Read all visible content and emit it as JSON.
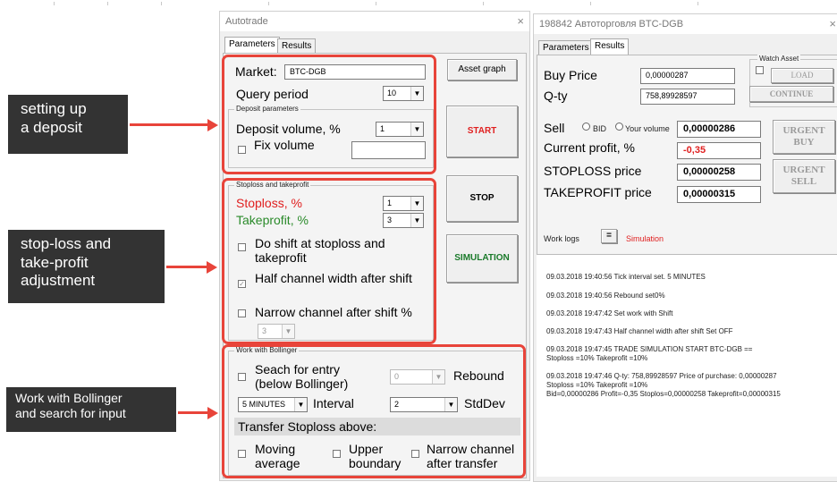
{
  "callouts": {
    "deposit": "setting up\na deposit",
    "stoploss": "stop-loss and\ntake-profit\nadjustment",
    "bollinger": "Work with Bollinger\nand search for input"
  },
  "colors": {
    "callout_bg": "#333333",
    "highlight": "#e8443a",
    "red_text": "#e02020",
    "green_text": "#2a8a2a"
  },
  "left_window": {
    "title": "Autotrade",
    "close_icon": "×",
    "tabs": [
      {
        "label": "Parameters",
        "active": true
      },
      {
        "label": "Results",
        "active": false
      }
    ],
    "market_label": "Market:",
    "market_value": "BTC-DGB",
    "asset_graph_button": "Asset graph",
    "query_period_label": "Query period",
    "query_period_value": "10",
    "deposit_group_title": "Deposit parameters",
    "deposit_volume_label": "Deposit volume, %",
    "deposit_volume_value": "1",
    "fix_volume_label": "Fix volume",
    "fix_volume_value": "",
    "start_button": "START",
    "stop_group_title": "Stoploss and takeprofit",
    "stoploss_label": "Stoploss, %",
    "stoploss_value": "1",
    "takeprofit_label": "Takeprofit, %",
    "takeprofit_value": "3",
    "stop_button": "STOP",
    "shift_label": "Do shift at stoploss and\ntakeprofit",
    "half_channel_label": "Half channel width after shift",
    "half_channel_checked": true,
    "narrow_label": "Narrow channel after shift %",
    "narrow_value": "3",
    "simulation_button": "SIMULATION",
    "bollinger_group_title": "Work with Bollinger",
    "search_entry_label": "Seach for entry\n(below Bollinger)",
    "rebound_value": "0",
    "rebound_label": "Rebound",
    "interval_value": "5 MINUTES",
    "interval_label": "Interval",
    "stddev_value": "2",
    "stddev_label": "StdDev",
    "transfer_label": "Transfer Stoploss above:",
    "moving_average_label": "Moving\naverage",
    "upper_boundary_label": "Upper\nboundary",
    "narrow_transfer_label": "Narrow channel\nafter transfer"
  },
  "right_window": {
    "title": "198842 Автоторговля BTC-DGB",
    "close_icon": "×",
    "tabs": [
      {
        "label": "Parameters",
        "active": false
      },
      {
        "label": "Results",
        "active": true
      }
    ],
    "buy_price_label": "Buy Price",
    "buy_price_value": "0,00000287",
    "qty_label": "Q-ty",
    "qty_value": "758,89928597",
    "watch_asset_title": "Watch Asset",
    "load_button": "LOAD",
    "continue_button": "CONTINUE",
    "sell_label": "Sell",
    "bid_label": "BID",
    "your_volume_label": "Your volume",
    "sell_value": "0,00000286",
    "current_profit_label": "Current profit, %",
    "current_profit_value": "-0,35",
    "stoploss_price_label": "STOPLOSS price",
    "stoploss_price_value": "0,00000258",
    "takeprofit_price_label": "TAKEPROFIT price",
    "takeprofit_price_value": "0,00000315",
    "urgent_buy_button": "URGENT\nBUY",
    "urgent_sell_button": "URGENT\nSELL",
    "work_logs_label": "Work logs",
    "logs_toggle": "=",
    "simulation_label": "Simulation",
    "logs": [
      "09.03.2018 19:40:56 Tick interval set. 5 MINUTES",
      "09.03.2018 19:40:56 Rebound set0%",
      "09.03.2018 19:47:42 Set work with Shift",
      "09.03.2018 19:47:43 Half channel width after shift Set OFF",
      "09.03.2018 19:47:45 TRADE SIMULATION START BTC-DGB ==\n Stoploss =10% Takeprofit =10%",
      "09.03.2018 19:47:46 Q-ty: 758,89928597 Price of purchase: 0,00000287\nStoploss =10% Takeprofit =10%\nBid=0,00000286 Profit=-0,35 Stoplos=0,00000258 Takeprofit=0,00000315"
    ]
  }
}
